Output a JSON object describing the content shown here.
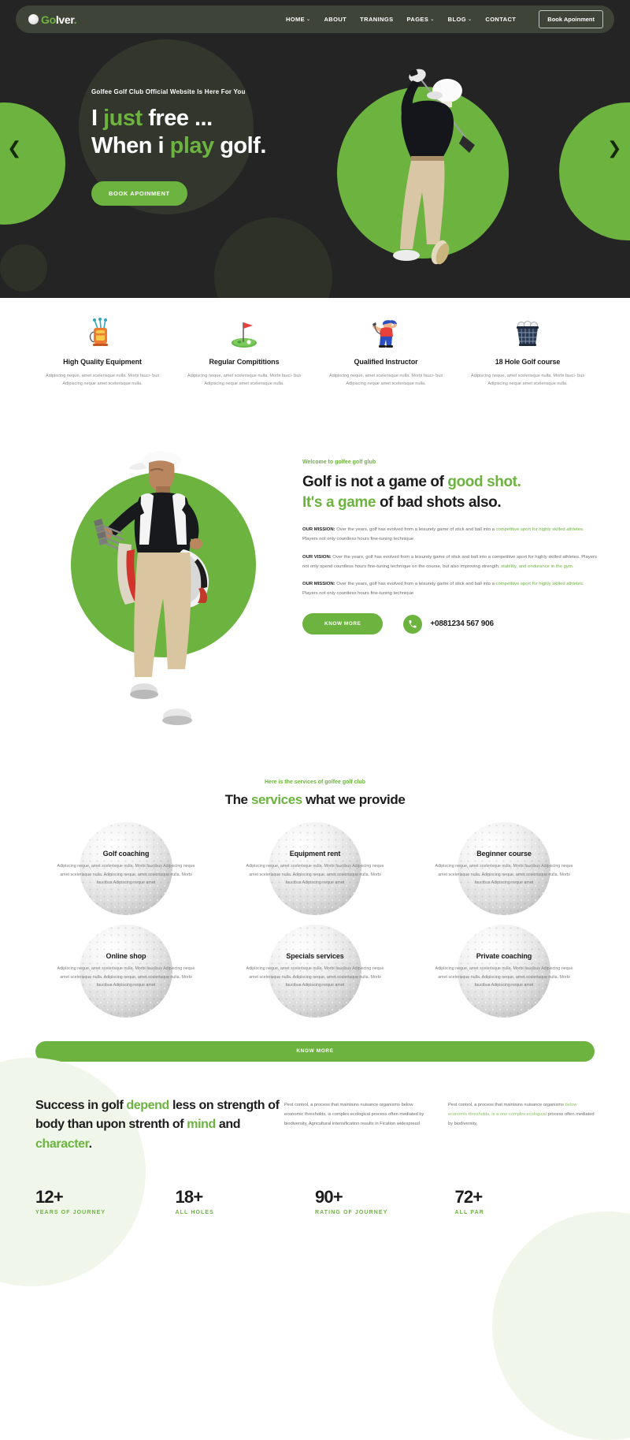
{
  "brand": {
    "ball_icon": "golf-ball-icon",
    "part1": "Go",
    "part2": "lver",
    "dot": "."
  },
  "nav": {
    "items": [
      {
        "label": "HOME",
        "has_caret": true
      },
      {
        "label": "ABOUT",
        "has_caret": false
      },
      {
        "label": "TRANINGS",
        "has_caret": false
      },
      {
        "label": "PAGES",
        "has_caret": true
      },
      {
        "label": "BLOG",
        "has_caret": true
      },
      {
        "label": "CONTACT",
        "has_caret": false
      }
    ],
    "cta_label": "Book Apoinment"
  },
  "hero": {
    "eyebrow": "Golfee Golf Club Official Website Is Here For You",
    "line1_a": "I ",
    "line1_hl": "just",
    "line1_b": " free ...",
    "line2_a": "When i ",
    "line2_hl": "play",
    "line2_b": " golf.",
    "button_label": "BOOK APOINMENT",
    "prev_icon": "chevron-left-icon",
    "next_icon": "chevron-right-icon",
    "accent_color": "#6cb33f",
    "bg_color": "#242424"
  },
  "features": [
    {
      "icon": "golf-bag-icon",
      "title": "High Quality Equipment",
      "desc": "Adipiscing neque, amet scelerisque nulla. Morbi fauci- bus Adipiscing neque amet scelerisque nulla."
    },
    {
      "icon": "golf-flag-green-icon",
      "title": "Regular Compititions",
      "desc": "Adipiscing neque, amet scelerisque nulla. Morbi fauci- bus Adipiscing neque amet scelerisque nulla."
    },
    {
      "icon": "golfer-instructor-icon",
      "title": "Qualified Instructor",
      "desc": "Adipiscing neque, amet scelerisque nulla. Morbi fauci- bus Adipiscing neque amet scelerisque nulla."
    },
    {
      "icon": "ball-basket-icon",
      "title": "18 Hole Golf course",
      "desc": "Adipiscing neque, amet scelerisque nulla. Morbi fauci- bus Adipiscing neque amet scelerisque nulla."
    }
  ],
  "about": {
    "image_alt": "golfer-carrying-bag-photo",
    "eyebrow": "Welcome to golfee golf glub",
    "title_a": "Golf is not a game of ",
    "title_hl1": "good shot.",
    "title_hl2": "It's a game",
    "title_b": " of bad shots also.",
    "paras": [
      {
        "label": "OUR MISSION:",
        "t1": " Over the years, golf has evolved from a leisurely game of stick and ball into a ",
        "hl": "competitive sport for highly skilled athletes",
        "t2": ". Players not only countless hours fine-tuning technique"
      },
      {
        "label": "OUR VISION:",
        "t1": " Over the years, golf has evolved from a leisurely game of stick and ball into a competitive sport for highly skilled athletes. Players not only spend countless hours fine-tuning technique on the course, but also improving strength, ",
        "hl": "stability, and endurance in the gym.",
        "t2": ""
      },
      {
        "label": "OUR MISSION:",
        "t1": " Over the years, golf has evolved from a leisurely game of stick and ball into a ",
        "hl": "competitive sport for highly skilled athletes",
        "t2": ". Players not only countless hours fine-tuning technique"
      }
    ],
    "know_more_label": "KNOW MORE",
    "phone_icon": "phone-icon",
    "phone_number": "+0881234 567 906"
  },
  "services": {
    "eyebrow": "Here is the services of golfee golf club",
    "title_a": "The ",
    "title_hl": "services",
    "title_b": " what we provide",
    "items": [
      {
        "title": "Golf coaching",
        "desc": "Adipiscing neque, amet scelerisque nulla. Morbi faucibus Adipiscing neque amet scelerisque nulla. Adipiscing neque, amet scelerisque nulla. Morbi faucibus Adipiscing neque amet"
      },
      {
        "title": "Equipment rent",
        "desc": "Adipiscing neque, amet scelerisque nulla. Morbi faucibus Adipiscing neque amet scelerisque nulla. Adipiscing neque, amet scelerisque nulla. Morbi faucibus Adipiscing neque amet"
      },
      {
        "title": "Beginner course",
        "desc": "Adipiscing neque, amet scelerisque nulla. Morbi faucibus Adipiscing neque amet scelerisque nulla. Adipiscing neque, amet scelerisque nulla. Morbi faucibus Adipiscing neque amet"
      },
      {
        "title": "Online shop",
        "desc": "Adipiscing neque, amet scelerisque nulla. Morbi faucibus Adipiscing neque amet scelerisque nulla. Adipiscing neque, amet scelerisque nulla. Morbi faucibus Adipiscing neque amet"
      },
      {
        "title": "Specials services",
        "desc": "Adipiscing neque, amet scelerisque nulla. Morbi faucibus Adipiscing neque amet scelerisque nulla. Adipiscing neque, amet scelerisque nulla. Morbi faucibus Adipiscing neque amet"
      },
      {
        "title": "Private coaching",
        "desc": "Adipiscing neque, amet scelerisque nulla. Morbi faucibus Adipiscing neque amet scelerisque nulla. Adipiscing neque, amet scelerisque nulla. Morbi faucibus Adipiscing neque amet"
      }
    ],
    "know_more_label": "KNOW MORE"
  },
  "success": {
    "title_a": "Success in golf ",
    "title_hl1": "depend",
    "title_b": " less on strength of body than upon strenth of ",
    "title_hl2": "mind",
    "title_c": " and ",
    "title_hl3": "character",
    "title_d": ".",
    "col1_t1": "Pest control, a process that maintains nuisance organisms below economic thresholds, is complex ecological process often mediated by biodiversity, Agricultural intensification results in Fication widespread",
    "col2_t1": "Pest control, a process that maintains nuisance organisms ",
    "col2_hl1": "below economic thresholds, is a one complex ecological",
    "col2_t2": " process often mediated by biodiversity,"
  },
  "stats": [
    {
      "number": "12+",
      "label": "YEARS OF JOURNEY"
    },
    {
      "number": "18+",
      "label": "ALL HOLES"
    },
    {
      "number": "90+",
      "label": "RATING OF JOURNEY"
    },
    {
      "number": "72+",
      "label": "ALL PAR"
    }
  ]
}
